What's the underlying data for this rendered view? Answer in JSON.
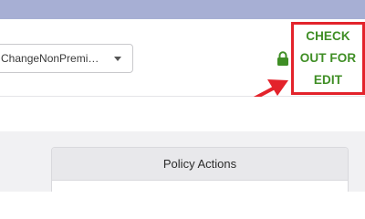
{
  "policy_select": {
    "value": "ChangeNonPremiu..."
  },
  "checkout": {
    "label": "CHECK OUT FOR EDIT",
    "label_color": "#3f8e25",
    "highlight_color": "#e3232b"
  },
  "lock": {
    "icon": "lock-icon",
    "color": "#3f8e25"
  },
  "policy_actions": {
    "title": "Policy Actions"
  },
  "colors": {
    "topbar": "#a7afd4",
    "annotation": "#e3232b"
  }
}
